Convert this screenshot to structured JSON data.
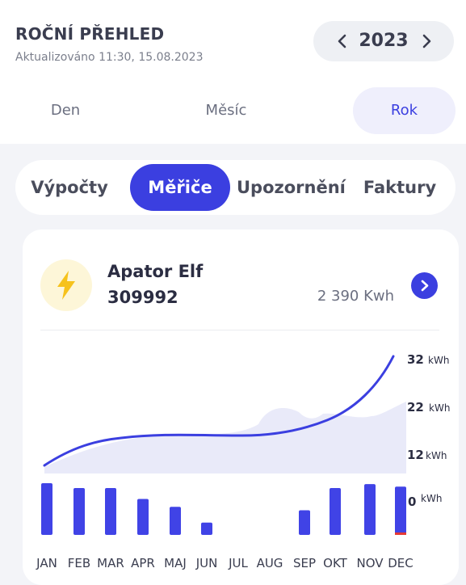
{
  "header": {
    "title": "ROČNÍ PŘEHLED",
    "updated": "Aktualizováno 11:30, 15.08.2023",
    "year": "2023"
  },
  "period_tabs": [
    {
      "label": "Den",
      "active": false
    },
    {
      "label": "Měsíc",
      "active": false
    },
    {
      "label": "Rok",
      "active": true
    }
  ],
  "section_tabs": [
    {
      "label": "Výpočty",
      "active": false
    },
    {
      "label": "Měřiče",
      "active": true
    },
    {
      "label": "Upozornění",
      "active": false
    },
    {
      "label": "Faktury",
      "active": false
    }
  ],
  "meter": {
    "name": "Apator Elf",
    "id": "309992",
    "total": "2 390 Kwh",
    "icon": "lightning-icon"
  },
  "colors": {
    "accent": "#3b3fe0",
    "bar": "#4043e6",
    "alert": "#e53935",
    "area": "#d9daf5"
  },
  "chart_data": {
    "type": "bar",
    "categories": [
      "JAN",
      "FEB",
      "MAR",
      "APR",
      "MAJ",
      "JUN",
      "JUL",
      "AUG",
      "SEP",
      "OKT",
      "NOV",
      "DEC"
    ],
    "values": [
      10.5,
      9.5,
      9.5,
      7.3,
      5.7,
      2.5,
      0,
      0,
      5,
      9.5,
      10.3,
      9.8
    ],
    "y_ticks": [
      "32",
      "22",
      "12",
      "0"
    ],
    "y_unit": "kWh",
    "line_ylim": [
      0,
      32
    ]
  }
}
